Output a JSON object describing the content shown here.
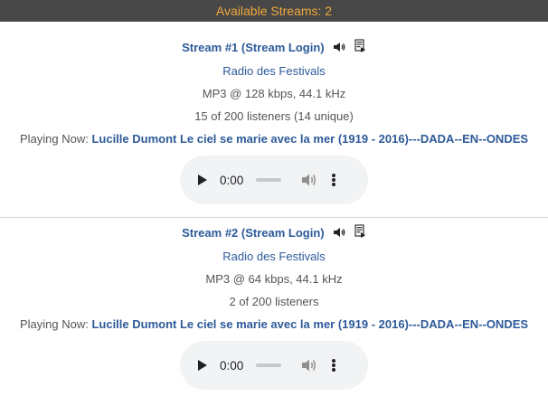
{
  "header": {
    "label": "Available Streams: 2"
  },
  "streams": [
    {
      "title": "Stream #1 (Stream Login)",
      "icons": [
        "speaker-icon",
        "playlist-icon"
      ],
      "name": "Radio des Festivals",
      "format": "MP3 @ 128 kbps, 44.1 kHz",
      "listeners": "15 of 200 listeners (14 unique)",
      "now_playing_label": "Playing Now:",
      "now_playing": "Lucille Dumont Le ciel se marie avec la mer (1919 - 2016)---DADA--EN--ONDES",
      "player": {
        "time": "0:00"
      }
    },
    {
      "title": "Stream #2 (Stream Login)",
      "icons": [
        "speaker-icon",
        "playlist-icon"
      ],
      "name": "Radio des Festivals",
      "format": "MP3 @ 64 kbps, 44.1 kHz",
      "listeners": "2 of 200 listeners",
      "now_playing_label": "Playing Now:",
      "now_playing": "Lucille Dumont Le ciel se marie avec la mer (1919 - 2016)---DADA--EN--ONDES",
      "player": {
        "time": "0:00"
      }
    }
  ],
  "colors": {
    "header_bg": "#474747",
    "header_text": "#f0a83c",
    "link": "#2d5a99",
    "player_bg": "#f1f3f4"
  }
}
